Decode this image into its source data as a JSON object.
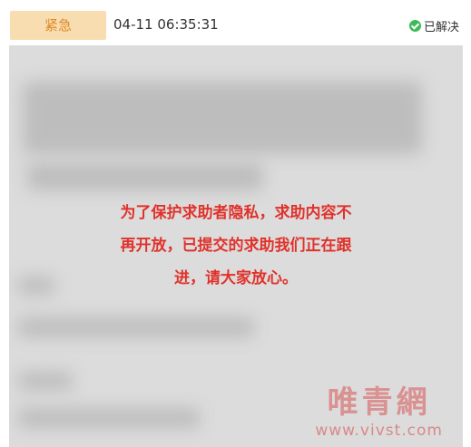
{
  "header": {
    "urgency_badge": "紧急",
    "timestamp": "04-11 06:35:31",
    "status_text": "已解决"
  },
  "notice": {
    "line1": "为了保护求助者隐私，求助内容不",
    "line2": "再开放，已提交的求助我们正在跟",
    "line3": "进，请大家放心。"
  },
  "watermark": {
    "logo_text": "唯青網",
    "url": "www.vivst.com"
  },
  "colors": {
    "badge_bg": "#f8ddb0",
    "badge_text": "#e08a2a",
    "notice_text": "#e0322b",
    "status_check": "#3dbb59",
    "panel_bg": "#dcdcdc"
  },
  "icons": {
    "status": "check-circle-icon"
  }
}
